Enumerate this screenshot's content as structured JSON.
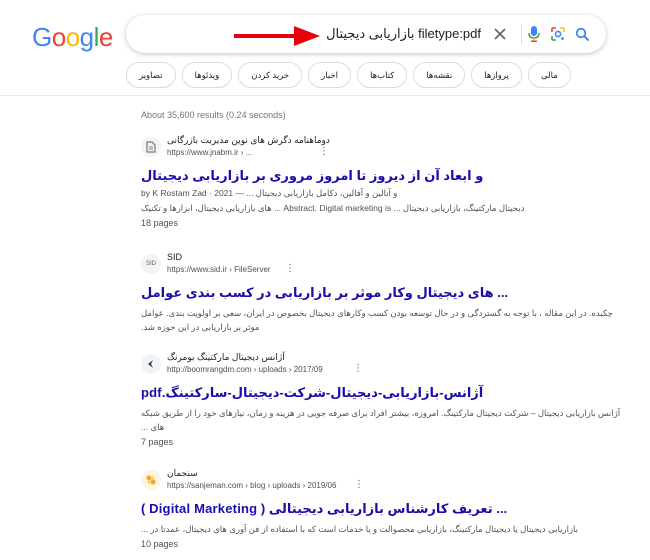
{
  "logo": {
    "text": "Google",
    "colors": [
      "#4285F4",
      "#EA4335",
      "#FBBC05",
      "#4285F4",
      "#34A853",
      "#EA4335"
    ]
  },
  "search": {
    "query": "filetype:pdf بازاریابی دیجیتال"
  },
  "chips": [
    "مالی",
    "پروازها",
    "نقشه‌ها",
    "کتاب‌ها",
    "اخبار",
    "خرید کردن",
    "ویدئوها",
    "تصاویر"
  ],
  "stats": "About 35,600 results (0.24 seconds)",
  "results": [
    {
      "site": "دوماهنامه دگرش های نوین مدیریت بازرگانی",
      "url": "https://www.jnabm.ir › ...",
      "title": "و ابعاد آن از دیروز تا امروز مروری بر بازاریابی دیجیتال",
      "meta": "by K Rostam Zad · 2021 — ... و آنالین و آفالین، دکامل بازاریابی دیجیتال",
      "snippet": "دیجیتال مارکتینگ، بازاریابی دیجیتال ... Abstract. Digital marketing is ... های بازاریابی دیجیتال، ابزارها و تکنیک",
      "pages": "18 pages"
    },
    {
      "site": "SID",
      "url": "https://www.sid.ir › FileServer",
      "title": "... های دیجیتال وکار موثر بر بازاریابی در کسب بندی عوامل",
      "snippet": "چکیده. در این مقاله ، با توجه به گستردگی و در حال توسعه بودن کسب وکارهای دیجیتال بخصوص در ایران، سعی بر اولویت بندی. عوامل موثر بر بازاریابی در این حوزه شد.",
      "pages": ""
    },
    {
      "site": "آژانس دیجیتال مارکتینگ بومرنگ",
      "url": "http://boomrangdm.com › uploads › 2017/09",
      "title": "آژانس-بازاریابی-دیجیتال-شرکت-دیجیتال-سارکتینگ.pdf",
      "snippet": "آژانس بازاریابی دیجیتال – شرکت دیجیتال مارکتینگ. امروزه، بیشتر افراد برای صرفه جویی در هزینه و زمان، نیازهای خود را از طریق شبکه های ...",
      "pages": "7 pages"
    },
    {
      "site": "سنجمان",
      "url": "https://sanjeman.com › blog › uploads › 2019/06",
      "title": "... تعریف کارشناس بازاریابی دیجیتالی ( Digital Marketing )",
      "snippet": "بازاریابی دیجیتال یا دیجیتال مارکتینگ، بازاریابی محصوالت و یا خدمات است که با استفاده از فن آوری های دیجیتال، عمدتا در ...",
      "pages": "10 pages"
    }
  ],
  "colors": {
    "link": "#1a0dab",
    "arrow": "#e8000b",
    "mic": "#4285F4"
  }
}
